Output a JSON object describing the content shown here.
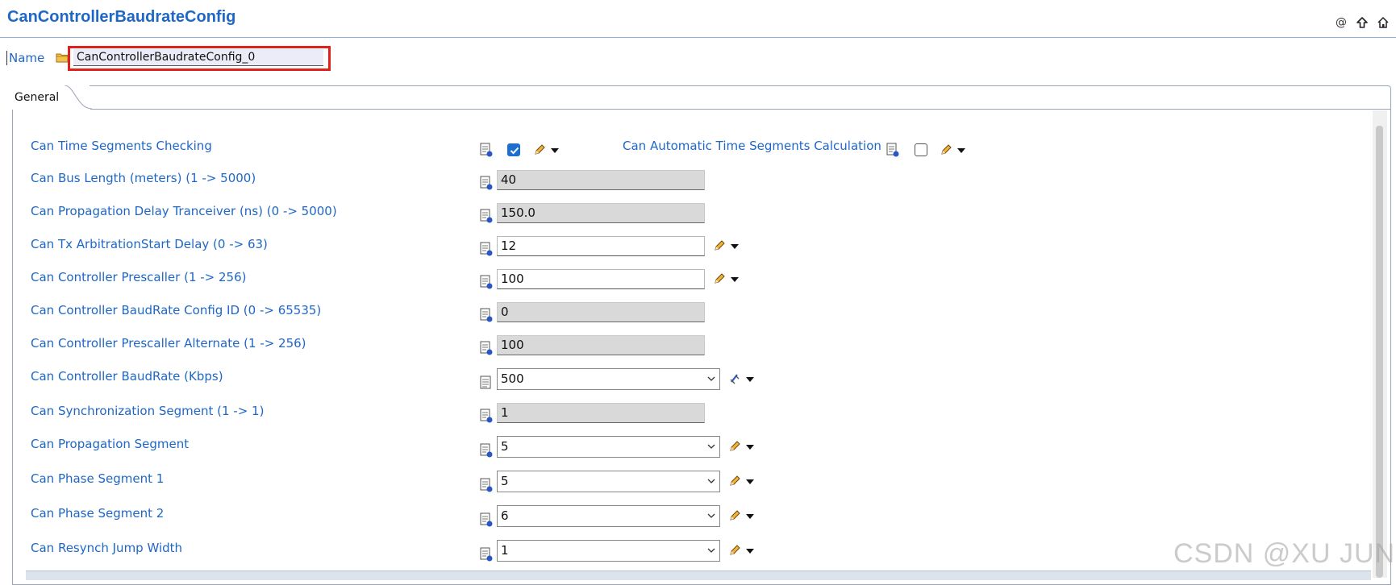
{
  "header": {
    "title": "CanControllerBaudrateConfig",
    "icons": [
      "at-icon",
      "up-arrow-icon",
      "home-icon"
    ]
  },
  "name_row": {
    "label": "Name",
    "value": "CanControllerBaudrateConfig_0"
  },
  "tabs": [
    {
      "label": "General"
    }
  ],
  "rows": {
    "time_seg_check": {
      "label": "Can Time Segments Checking",
      "checked": true
    },
    "auto_time_seg": {
      "label": "Can Automatic Time Segments Calculation",
      "checked": false
    },
    "bus_length": {
      "label": "Can Bus Length (meters) (1 -> 5000)",
      "value": "40"
    },
    "prop_delay": {
      "label": "Can Propagation Delay Tranceiver (ns) (0 -> 5000)",
      "value": "150.0"
    },
    "tx_arb": {
      "label": "Can Tx ArbitrationStart Delay (0 -> 63)",
      "value": "12"
    },
    "prescaller": {
      "label": "Can Controller Prescaller (1 -> 256)",
      "value": "100"
    },
    "baudrate_id": {
      "label": "Can Controller BaudRate Config ID (0 -> 65535)",
      "value": "0"
    },
    "prescaller_alt": {
      "label": "Can Controller Prescaller Alternate (1 -> 256)",
      "value": "100"
    },
    "baudrate": {
      "label": "Can Controller BaudRate (Kbps)",
      "value": "500"
    },
    "sync_seg": {
      "label": "Can Synchronization Segment (1 -> 1)",
      "value": "1"
    },
    "prop_seg": {
      "label": "Can Propagation Segment",
      "value": "5"
    },
    "phase_seg1": {
      "label": "Can Phase Segment 1",
      "value": "5"
    },
    "phase_seg2": {
      "label": "Can Phase Segment 2",
      "value": "6"
    },
    "resync_jump": {
      "label": "Can Resynch Jump Width",
      "value": "1"
    }
  },
  "watermark": "CSDN @XU JUNNY",
  "colors": {
    "label_blue": "#1f67c6",
    "highlight_red": "#e0201b",
    "checkbox_blue": "#1c6fd1",
    "readonly_gray": "#d9d9d9"
  }
}
